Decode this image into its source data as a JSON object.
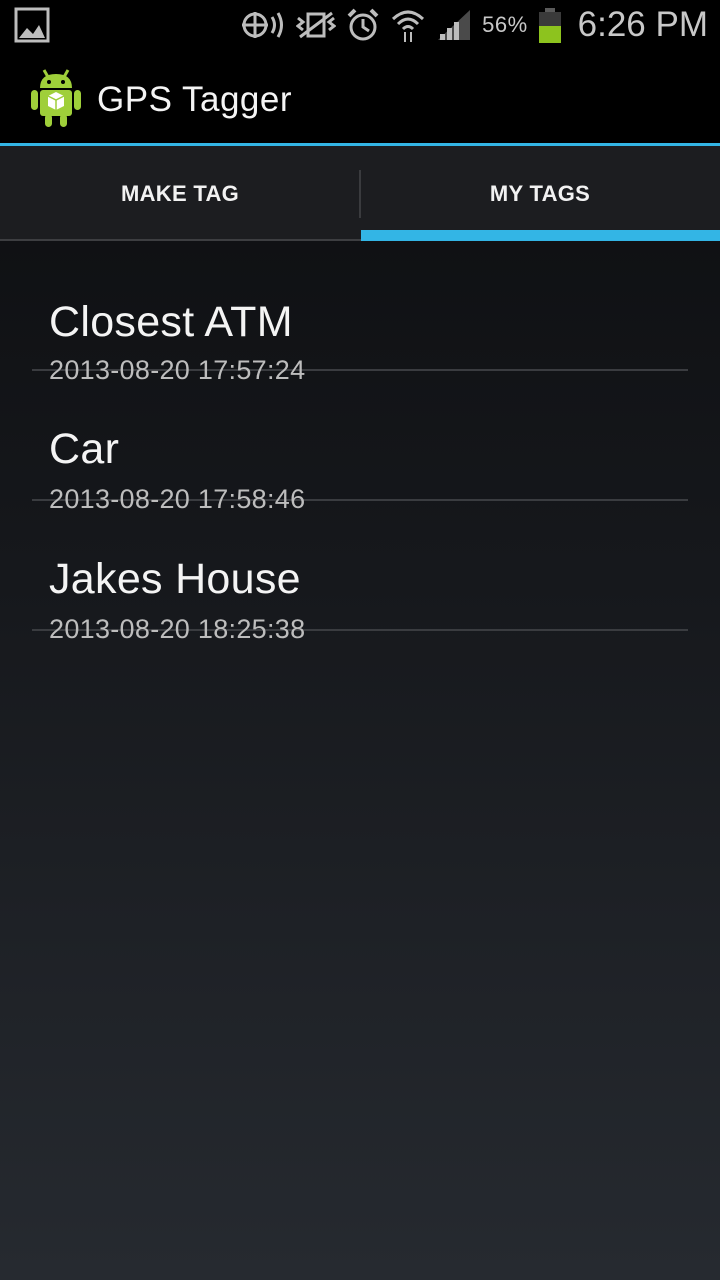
{
  "status_bar": {
    "icons": [
      "gallery-icon",
      "location-icon",
      "vibrate-icon",
      "alarm-icon",
      "wifi-icon",
      "signal-icon",
      "battery-icon"
    ],
    "battery_percent": "56%",
    "battery_level": 0.56,
    "time": "6:26 PM",
    "battery_color": "#8dc31e"
  },
  "action_bar": {
    "title": "GPS Tagger",
    "accent_color": "#33b5e5"
  },
  "tabs": [
    {
      "label": "MAKE TAG",
      "selected": false
    },
    {
      "label": "MY TAGS",
      "selected": true
    }
  ],
  "tags": [
    {
      "name": "Closest ATM",
      "date": "2013-08-20 17:57:24"
    },
    {
      "name": "Car",
      "date": "2013-08-20 17:58:46"
    },
    {
      "name": "Jakes House",
      "date": "2013-08-20 18:25:38"
    }
  ]
}
